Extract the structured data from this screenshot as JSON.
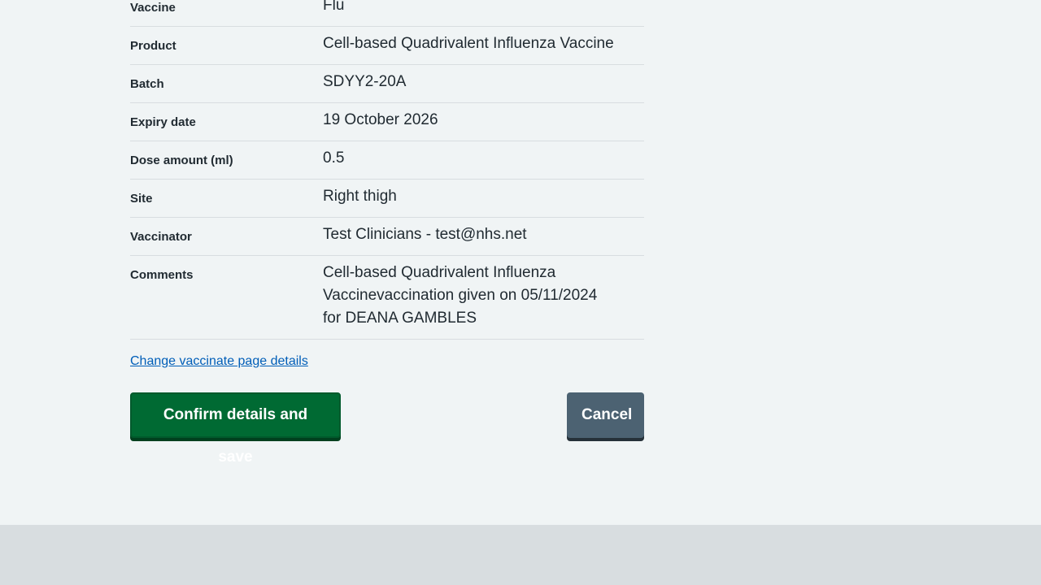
{
  "summary": {
    "rows": [
      {
        "key": "Vaccine",
        "value": "Flu"
      },
      {
        "key": "Product",
        "value": "Cell-based Quadrivalent Influenza Vaccine"
      },
      {
        "key": "Batch",
        "value": "SDYY2-20A"
      },
      {
        "key": "Expiry date",
        "value": "19 October 2026"
      },
      {
        "key": "Dose amount (ml)",
        "value": "0.5"
      },
      {
        "key": "Site",
        "value": "Right thigh"
      },
      {
        "key": "Vaccinator",
        "value": "Test Clinicians - test@nhs.net"
      },
      {
        "key": "Comments",
        "value": "Cell-based Quadrivalent Influenza Vaccinevaccination given on 05/11/2024 for DEANA GAMBLES"
      }
    ]
  },
  "links": {
    "change": "Change vaccinate page details"
  },
  "actions": {
    "confirm_label": "Confirm details and save",
    "cancel_label": "Cancel"
  },
  "colors": {
    "confirm_button": "#006a33",
    "cancel_button": "#4c6272",
    "link": "#005eb8",
    "page_background": "#f0f4f5",
    "footer_background": "#d8dde0"
  }
}
